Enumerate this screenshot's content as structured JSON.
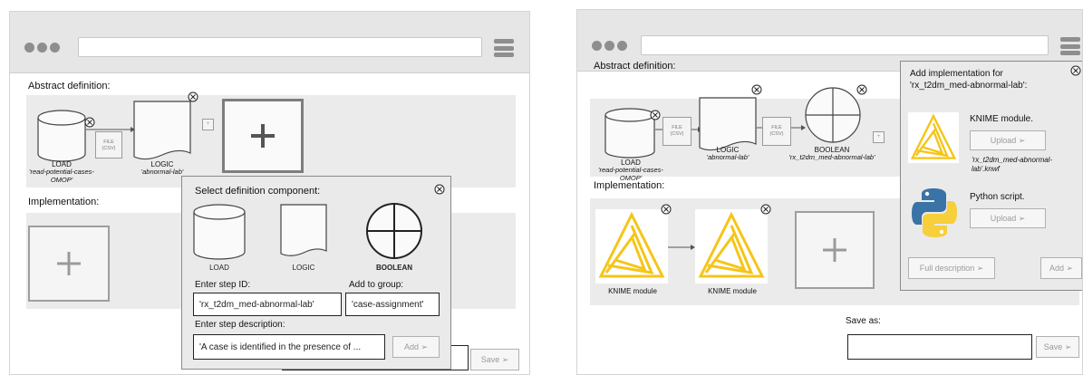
{
  "left": {
    "abstract_label": "Abstract definition:",
    "implementation_label": "Implementation:",
    "load": {
      "name": "LOAD",
      "id": "'read-potential-cases-OMOP'"
    },
    "file_line1": "FILE",
    "file_line2": "(CSV)",
    "logic": {
      "name": "LOGIC",
      "id": "'abnormal-lab'"
    },
    "small_plus": "+",
    "popup": {
      "title": "Select definition component:",
      "options": [
        "LOAD",
        "LOGIC",
        "BOOLEAN"
      ],
      "step_id_label": "Enter step ID:",
      "step_id_value": "'rx_t2dm_med-abnormal-lab'",
      "group_label": "Add to group:",
      "group_value": "'case-assignment'",
      "desc_label": "Enter step description:",
      "desc_value": "'A case is identified in the presence of ...",
      "add_button": "Add ➢"
    },
    "save_button": "Save ➢"
  },
  "right": {
    "abstract_label": "Abstract definition:",
    "implementation_label": "Implementation:",
    "load": {
      "name": "LOAD",
      "id": "'read-potential-cases-OMOP'"
    },
    "file_line1": "FILE",
    "file_line2": "(CSV)",
    "logic": {
      "name": "LOGIC",
      "id": "'abnormal-lab'"
    },
    "boolean": {
      "name": "BOOLEAN",
      "id": "'rx_t2dm_med-abnormal-lab'"
    },
    "small_plus": "+",
    "knime_caption_1": "KNIME module",
    "knime_caption_2": "KNIME module",
    "save_as_label": "Save as:",
    "save_button": "Save ➢",
    "panel": {
      "title": "Add implementation for 'rx_t2dm_med-abnormal-lab':",
      "knime_label": "KNIME module.",
      "upload_1": "Upload ➢",
      "knime_file": "'rx_t2dm_med-abnormal-lab'.knwf",
      "python_label": "Python script.",
      "upload_2": "Upload ➢",
      "full_desc_button": "Full description ➢",
      "add_button": "Add ➢"
    }
  },
  "colors": {
    "knime_yellow": "#f5c518",
    "python_blue": "#3a73a6",
    "python_yellow": "#f7cf3a"
  }
}
